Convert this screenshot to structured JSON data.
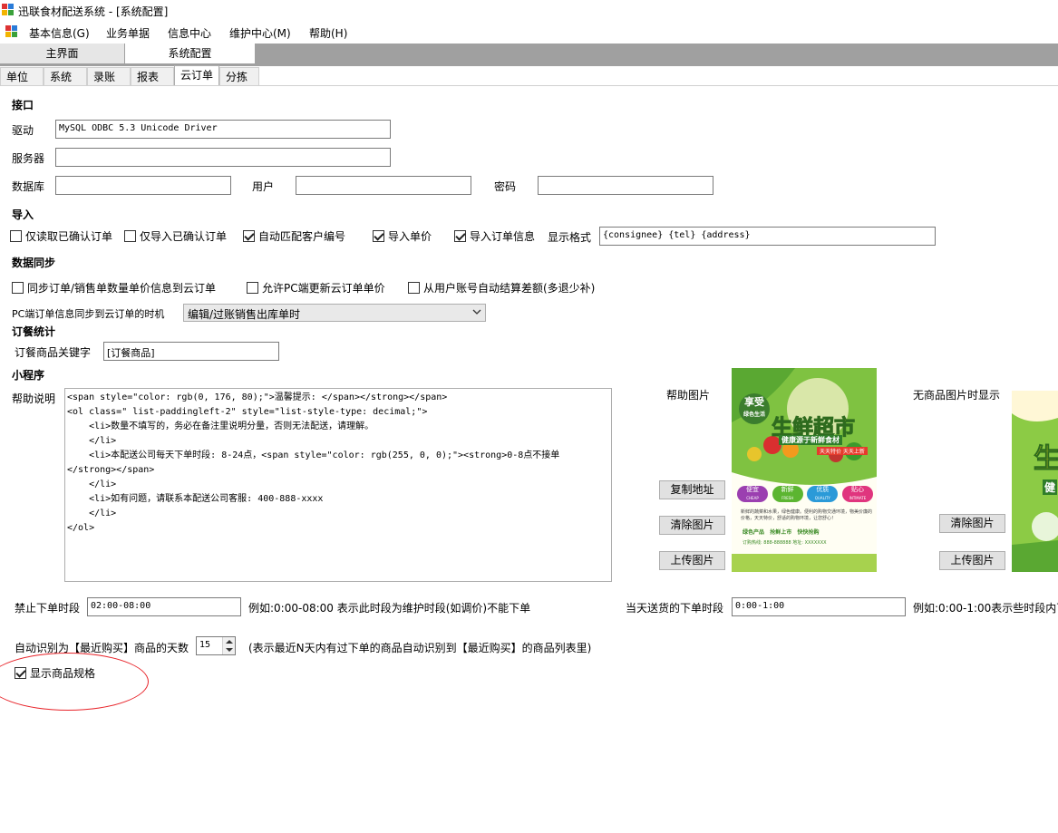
{
  "window": {
    "title": "迅联食材配送系统 - [系统配置]"
  },
  "menu": {
    "items": [
      {
        "label": "基本信息(G)"
      },
      {
        "label": "业务单据"
      },
      {
        "label": "信息中心"
      },
      {
        "label": "维护中心(M)"
      },
      {
        "label": "帮助(H)"
      }
    ]
  },
  "doc_tabs": [
    {
      "label": "主界面",
      "active": false
    },
    {
      "label": "系统配置",
      "active": true
    }
  ],
  "sub_tabs": [
    {
      "label": "单位"
    },
    {
      "label": "系统"
    },
    {
      "label": "录账"
    },
    {
      "label": "报表"
    },
    {
      "label": "云订单"
    },
    {
      "label": "分拣"
    }
  ],
  "interface": {
    "section": "接口",
    "driver_label": "驱动",
    "driver_value": "MySQL ODBC 5.3 Unicode Driver",
    "server_label": "服务器",
    "server_value": "",
    "database_label": "数据库",
    "database_value": "",
    "user_label": "用户",
    "user_value": "",
    "password_label": "密码",
    "password_value": ""
  },
  "import": {
    "section": "导入",
    "options": [
      {
        "label": "仅读取已确认订单",
        "checked": false
      },
      {
        "label": "仅导入已确认订单",
        "checked": false
      },
      {
        "label": "自动匹配客户编号",
        "checked": true
      },
      {
        "label": "导入单价",
        "checked": true
      },
      {
        "label": "导入订单信息",
        "checked": true
      }
    ],
    "display_format_label": "显示格式",
    "display_format_value": "{consignee} {tel} {address}"
  },
  "sync": {
    "section": "数据同步",
    "options": [
      {
        "label": "同步订单/销售单数量单价信息到云订单",
        "checked": false
      },
      {
        "label": "允许PC端更新云订单单价",
        "checked": false
      },
      {
        "label": "从用户账号自动结算差额(多退少补)",
        "checked": false
      }
    ],
    "timing_label": "PC端订单信息同步到云订单的时机",
    "timing_value": "编辑/过账销售出库单时"
  },
  "meal_stats": {
    "section": "订餐统计",
    "keyword_label": "订餐商品关键字",
    "keyword_value": "[订餐商品]"
  },
  "mini_program": {
    "section": "小程序",
    "help_label": "帮助说明",
    "help_lines": [
      "<span style=\"color: rgb(0, 176, 80);\">温馨提示: </span></strong></span>",
      "",
      "<ol class=\" list-paddingleft-2\" style=\"list-style-type: decimal;\">",
      "    <li>数量不填写的，务必在备注里说明分量，否则无法配送，请理解。",
      "    </li>",
      "    <li>本配送公司每天下单时段: 8-24点，<span style=\"color: rgb(255, 0, 0);\"><strong>0-8点不接单",
      "</strong></span>",
      "    </li>",
      "    <li>如有问题，请联系本配送公司客服: 400-888-xxxx",
      "    </li>",
      "</ol>"
    ],
    "help_image_label": "帮助图片",
    "copy_address_button": "复制地址",
    "clear_image_button": "清除图片",
    "upload_image_button": "上传图片",
    "no_product_image_label": "无商品图片时显示",
    "clear_image_button_2": "清除图片",
    "upload_image_button_2": "上传图片",
    "poster": {
      "badge": "享受",
      "badge_sub": "绿色生活",
      "headline": "生鲜超市",
      "subline": "健康源于新鲜食材",
      "ribbon": "天天特价 天天上新",
      "icons": [
        "便宜",
        "新鲜",
        "优质",
        "贴心"
      ],
      "icons_en": [
        "CHEAP",
        "FRESH",
        "QUALITY",
        "INTIMATE"
      ],
      "body": "新鲜的蔬菜和水果，绿色健康。便利的购物交通环境，物美价廉的价格，天天特价，舒适的购物环境，让您舒心！",
      "features": "绿色产品   抢鲜上市   快快抢购",
      "footer": "订购热线: 888-888888  地址: XXXXXXX"
    },
    "poster_2": {
      "headline": "生",
      "subline": "健"
    }
  },
  "order_time": {
    "forbid_label": "禁止下单时段",
    "forbid_value": "02:00-08:00",
    "forbid_hint": "例如:0:00-08:00 表示此时段为维护时段(如调价)不能下单",
    "sameday_label": "当天送货的下单时段",
    "sameday_value": "0:00-1:00",
    "sameday_hint": "例如:0:00-1:00表示些时段内下"
  },
  "recent": {
    "label": "自动识别为【最近购买】商品的天数",
    "days": "15",
    "hint": "(表示最近N天内有过下单的商品自动识别到【最近购买】的商品列表里)"
  },
  "show_spec": {
    "label": "显示商品规格",
    "checked": true
  },
  "colors": {
    "accent_red": "#e8242a",
    "tab_strip": "#a0a0a0"
  }
}
